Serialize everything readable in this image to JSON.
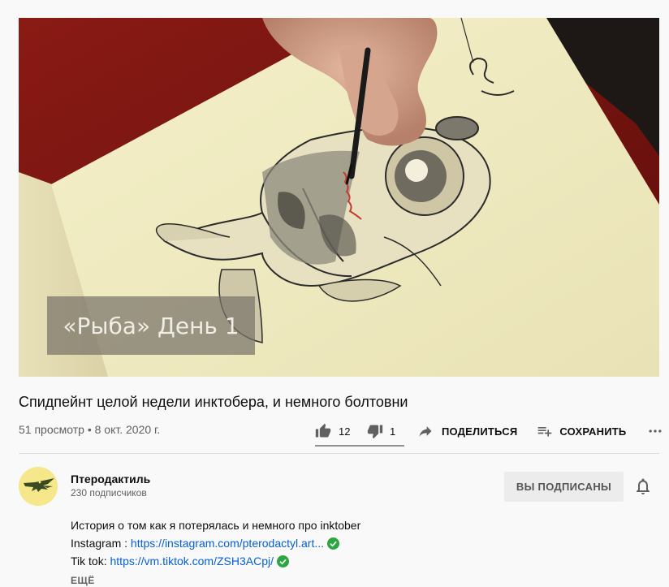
{
  "video": {
    "overlay_caption": "«Рыба» День 1",
    "title": "Спидпейнт целой недели инктобера, и немного болтовни",
    "views": "51 просмотр",
    "separator": "•",
    "date": "8 окт. 2020 г."
  },
  "actions": {
    "like_count": "12",
    "dislike_count": "1",
    "share_label": "ПОДЕЛИТЬСЯ",
    "save_label": "СОХРАНИТЬ"
  },
  "channel": {
    "name": "Птеродактиль",
    "subscribers": "230 подписчиков",
    "subscribed_label": "ВЫ ПОДПИСАНЫ"
  },
  "description": {
    "line1": "История о том как я потерялась и немного про inktober",
    "instagram_prefix": "Instagram : ",
    "instagram_link": "https://instagram.com/pterodactyl.art...",
    "tiktok_prefix": "Tik tok: ",
    "tiktok_link": "https://vm.tiktok.com/ZSH3ACpj/",
    "more_label": "ЕЩЁ"
  },
  "colors": {
    "link": "#065fd4",
    "verified": "#2ba640",
    "secondary_text": "#606060"
  }
}
